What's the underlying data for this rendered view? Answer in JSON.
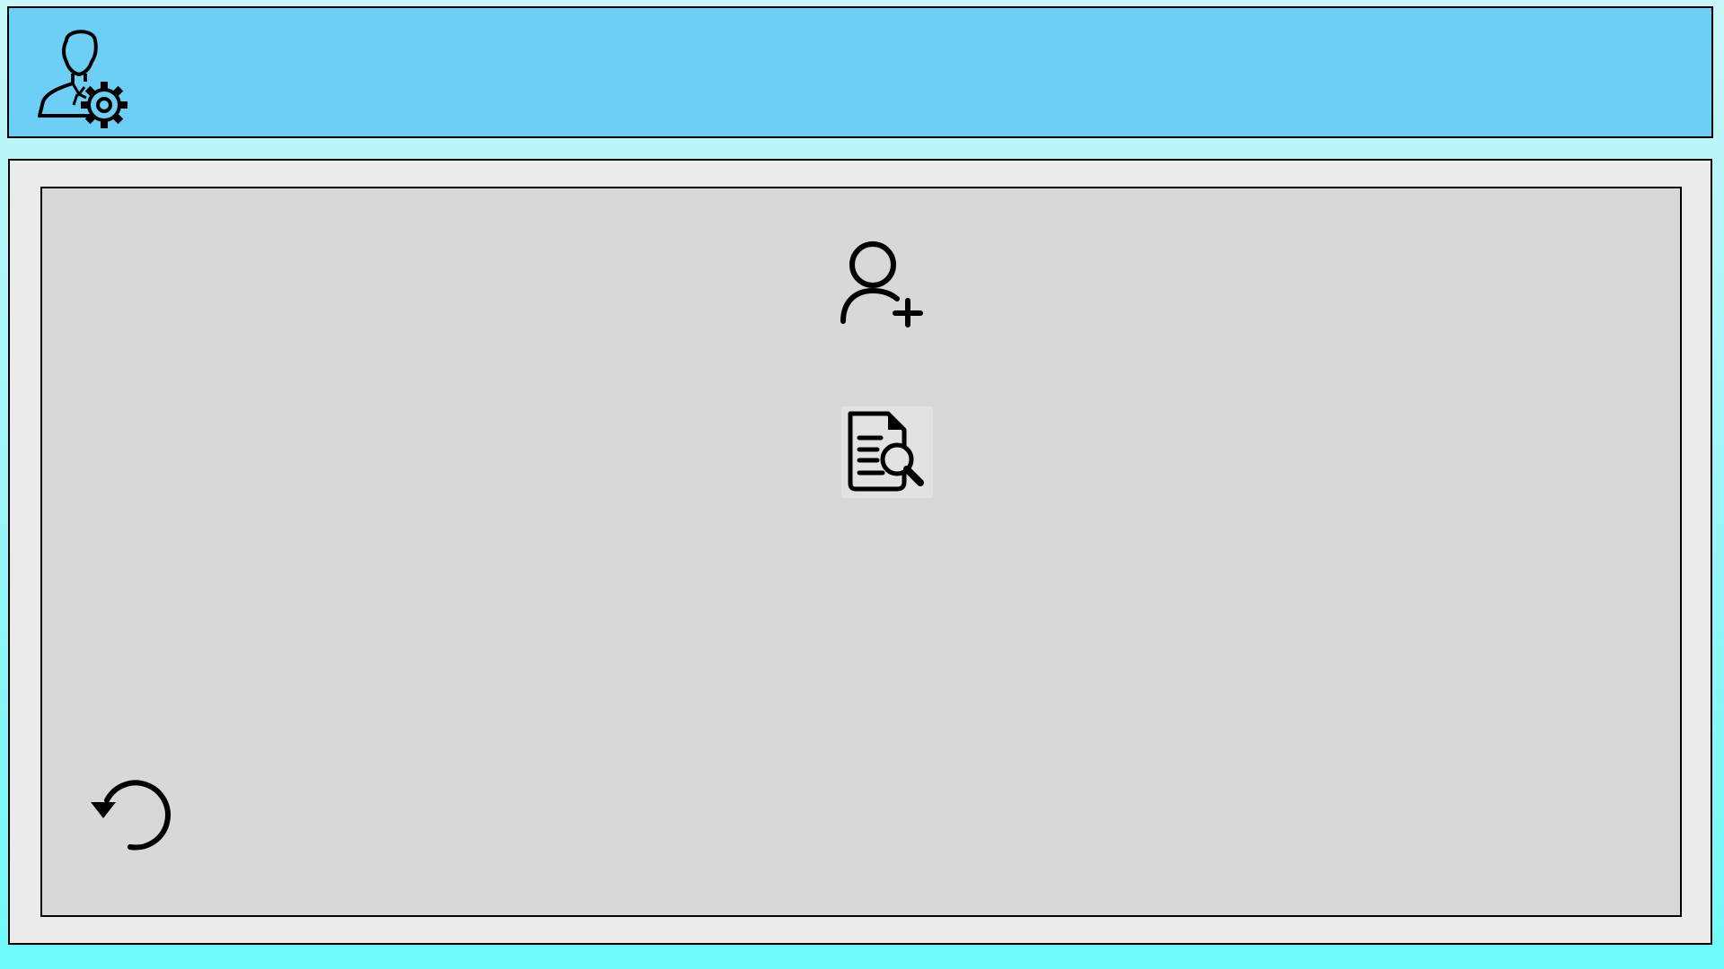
{
  "header": {
    "icon": "user-settings-icon",
    "background_color": "#6dcff6"
  },
  "main": {
    "background_color": "#ebebeb",
    "panel_color": "#d8d8d8",
    "actions": [
      {
        "icon": "add-user-icon"
      },
      {
        "icon": "document-search-icon"
      },
      {
        "icon": "undo-icon"
      }
    ]
  }
}
